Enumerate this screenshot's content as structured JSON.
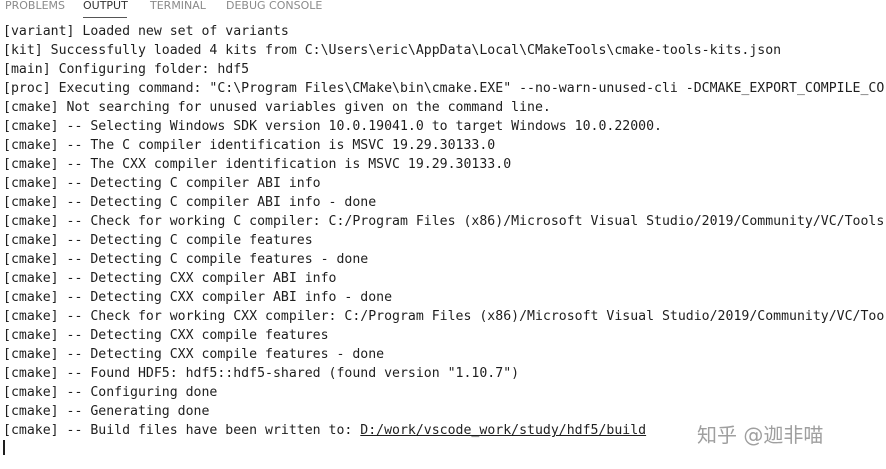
{
  "tabs": [
    {
      "label": "PROBLEMS",
      "active": false
    },
    {
      "label": "OUTPUT",
      "active": true
    },
    {
      "label": "TERMINAL",
      "active": false
    },
    {
      "label": "DEBUG CONSOLE",
      "active": false
    }
  ],
  "output": {
    "lines": [
      "[variant] Loaded new set of variants",
      "[kit] Successfully loaded 4 kits from C:\\Users\\eric\\AppData\\Local\\CMakeTools\\cmake-tools-kits.json",
      "[main] Configuring folder: hdf5",
      "[proc] Executing command: \"C:\\Program Files\\CMake\\bin\\cmake.EXE\" --no-warn-unused-cli -DCMAKE_EXPORT_COMPILE_CO",
      "[cmake] Not searching for unused variables given on the command line.",
      "[cmake] -- Selecting Windows SDK version 10.0.19041.0 to target Windows 10.0.22000.",
      "[cmake] -- The C compiler identification is MSVC 19.29.30133.0",
      "[cmake] -- The CXX compiler identification is MSVC 19.29.30133.0",
      "[cmake] -- Detecting C compiler ABI info",
      "[cmake] -- Detecting C compiler ABI info - done",
      "[cmake] -- Check for working C compiler: C:/Program Files (x86)/Microsoft Visual Studio/2019/Community/VC/Tools",
      "[cmake] -- Detecting C compile features",
      "[cmake] -- Detecting C compile features - done",
      "[cmake] -- Detecting CXX compiler ABI info",
      "[cmake] -- Detecting CXX compiler ABI info - done",
      "[cmake] -- Check for working CXX compiler: C:/Program Files (x86)/Microsoft Visual Studio/2019/Community/VC/Too",
      "[cmake] -- Detecting CXX compile features",
      "[cmake] -- Detecting CXX compile features - done",
      "[cmake] -- Found HDF5: hdf5::hdf5-shared (found version \"1.10.7\")",
      "[cmake] -- Configuring done",
      "[cmake] -- Generating done"
    ],
    "last_line_prefix": "[cmake] -- Build files have been written to: ",
    "last_line_link": "D:/work/vscode_work/study/hdf5/build"
  },
  "watermark": "知乎 @迦非喵"
}
